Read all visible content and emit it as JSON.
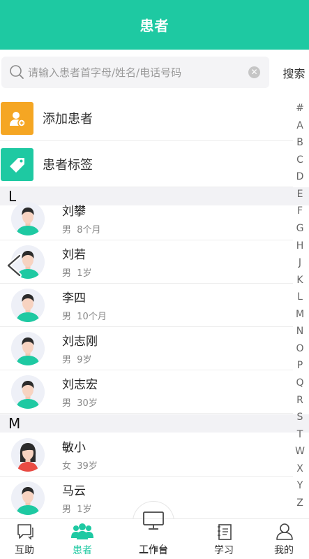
{
  "header": {
    "title": "患者"
  },
  "search": {
    "placeholder": "请输入患者首字母/姓名/电话号码",
    "button_label": "搜索"
  },
  "actions": [
    {
      "label": "添加患者",
      "color": "#f5a623",
      "icon": "add-user-icon"
    },
    {
      "label": "患者标签",
      "color": "#1ec9a2",
      "icon": "tag-icon"
    }
  ],
  "sections": [
    {
      "letter": "L",
      "patients": [
        {
          "name": "刘攀",
          "gender": "男",
          "age": "8个月",
          "avatar": "male"
        },
        {
          "name": "刘若",
          "gender": "男",
          "age": "1岁",
          "avatar": "male"
        },
        {
          "name": "李四",
          "gender": "男",
          "age": "10个月",
          "avatar": "male"
        },
        {
          "name": "刘志刚",
          "gender": "男",
          "age": "9岁",
          "avatar": "male"
        },
        {
          "name": "刘志宏",
          "gender": "男",
          "age": "30岁",
          "avatar": "male"
        }
      ]
    },
    {
      "letter": "M",
      "patients": [
        {
          "name": "敏小",
          "gender": "女",
          "age": "39岁",
          "avatar": "female"
        },
        {
          "name": "马云",
          "gender": "男",
          "age": "1岁",
          "avatar": "male"
        }
      ]
    }
  ],
  "index_letters": [
    "#",
    "A",
    "B",
    "C",
    "D",
    "E",
    "F",
    "G",
    "H",
    "J",
    "K",
    "L",
    "M",
    "N",
    "O",
    "P",
    "Q",
    "R",
    "S",
    "T",
    "W",
    "X",
    "Y",
    "Z"
  ],
  "tabs": [
    {
      "label": "互助",
      "icon": "chat-icon",
      "active": false
    },
    {
      "label": "患者",
      "icon": "patients-icon",
      "active": true
    },
    {
      "label": "工作台",
      "icon": "monitor-icon",
      "active": false
    },
    {
      "label": "学习",
      "icon": "book-icon",
      "active": false
    },
    {
      "label": "我的",
      "icon": "person-icon",
      "active": false
    }
  ],
  "colors": {
    "brand": "#1ec9a2",
    "orange": "#f5a623"
  }
}
